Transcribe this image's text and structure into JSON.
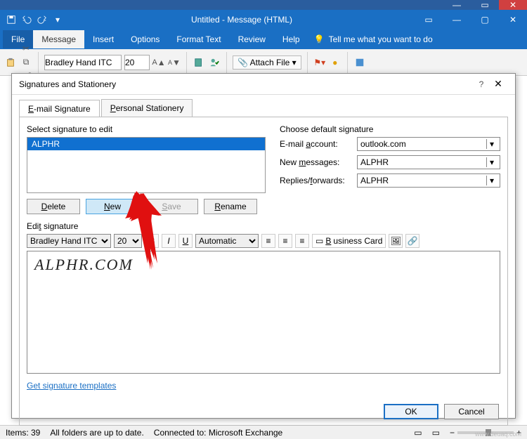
{
  "outer_window": {
    "minimize": "—",
    "maximize": "▭",
    "close": "✕"
  },
  "msg_window": {
    "title": "Untitled  -  Message (HTML)",
    "qat": [
      "save-icon",
      "undo-icon",
      "redo-icon",
      "down-icon"
    ],
    "wc": {
      "ribbon_opts": "▭",
      "min": "—",
      "max": "▢",
      "close": "✕"
    }
  },
  "ribbon_tabs": {
    "file": "File",
    "message": "Message",
    "insert": "Insert",
    "options": "Options",
    "format_text": "Format Text",
    "review": "Review",
    "help": "Help",
    "tell_me": "Tell me what you want to do"
  },
  "ribbon": {
    "clipboard_icons": [
      "paste-icon",
      "cut-icon",
      "copy-icon",
      "format-painter-icon"
    ],
    "font_name": "Bradley Hand ITC",
    "font_size": "20",
    "inc_font": "A▲",
    "dec_font": "A▼",
    "names_icons": [
      "address-book-icon",
      "check-names-icon"
    ],
    "attach_label": "Attach File",
    "attach_caret": "▾",
    "flag_icon": "flag-icon",
    "flag_color": "#d04020",
    "importance_icon": "●",
    "importance_color": "#e0a000",
    "addin_icon": "add-in-icon"
  },
  "dialog": {
    "title": "Signatures and Stationery",
    "help": "?",
    "close": "✕",
    "tab_email": "E-mail Signature",
    "tab_email_u": "E",
    "tab_stationery": "Personal Stationery",
    "tab_stationery_u": "P",
    "select_label": "Select signature to edit",
    "signatures": [
      "ALPHR"
    ],
    "btn_delete": "Delete",
    "btn_delete_u": "D",
    "btn_new": "New",
    "btn_new_u": "N",
    "btn_save": "Save",
    "btn_save_u": "S",
    "btn_rename": "Rename",
    "btn_rename_u": "R",
    "defaults_label": "Choose default signature",
    "account_label": "E-mail account:",
    "account_u": "a",
    "account_value": "outlook.com",
    "newmsg_label": "New messages:",
    "newmsg_u": "m",
    "newmsg_value": "ALPHR",
    "replies_label": "Replies/forwards:",
    "replies_u": "f",
    "replies_value": "ALPHR",
    "edit_label": "Edit signature",
    "edit_u": "t",
    "toolbar": {
      "font": "Bradley Hand ITC",
      "size": "20",
      "bold": "B",
      "italic": "I",
      "underline": "U",
      "color": "Automatic",
      "align_icons": [
        "align-left-icon",
        "align-center-icon",
        "align-right-icon"
      ],
      "bizcard": "Business Card",
      "extra_icons": [
        "picture-icon",
        "hyperlink-icon"
      ]
    },
    "signature_body": "ALPHR.COM",
    "templates": "Get signature templates",
    "ok": "OK",
    "cancel": "Cancel"
  },
  "status": {
    "items": "Items: 39",
    "folders": "All folders are up to date.",
    "connected": "Connected to: Microsoft Exchange",
    "view_icons": [
      "normal-view-icon",
      "reading-view-icon"
    ],
    "zoom_minus": "−",
    "zoom_plus": "+"
  },
  "watermark": "www.deuaq.com"
}
